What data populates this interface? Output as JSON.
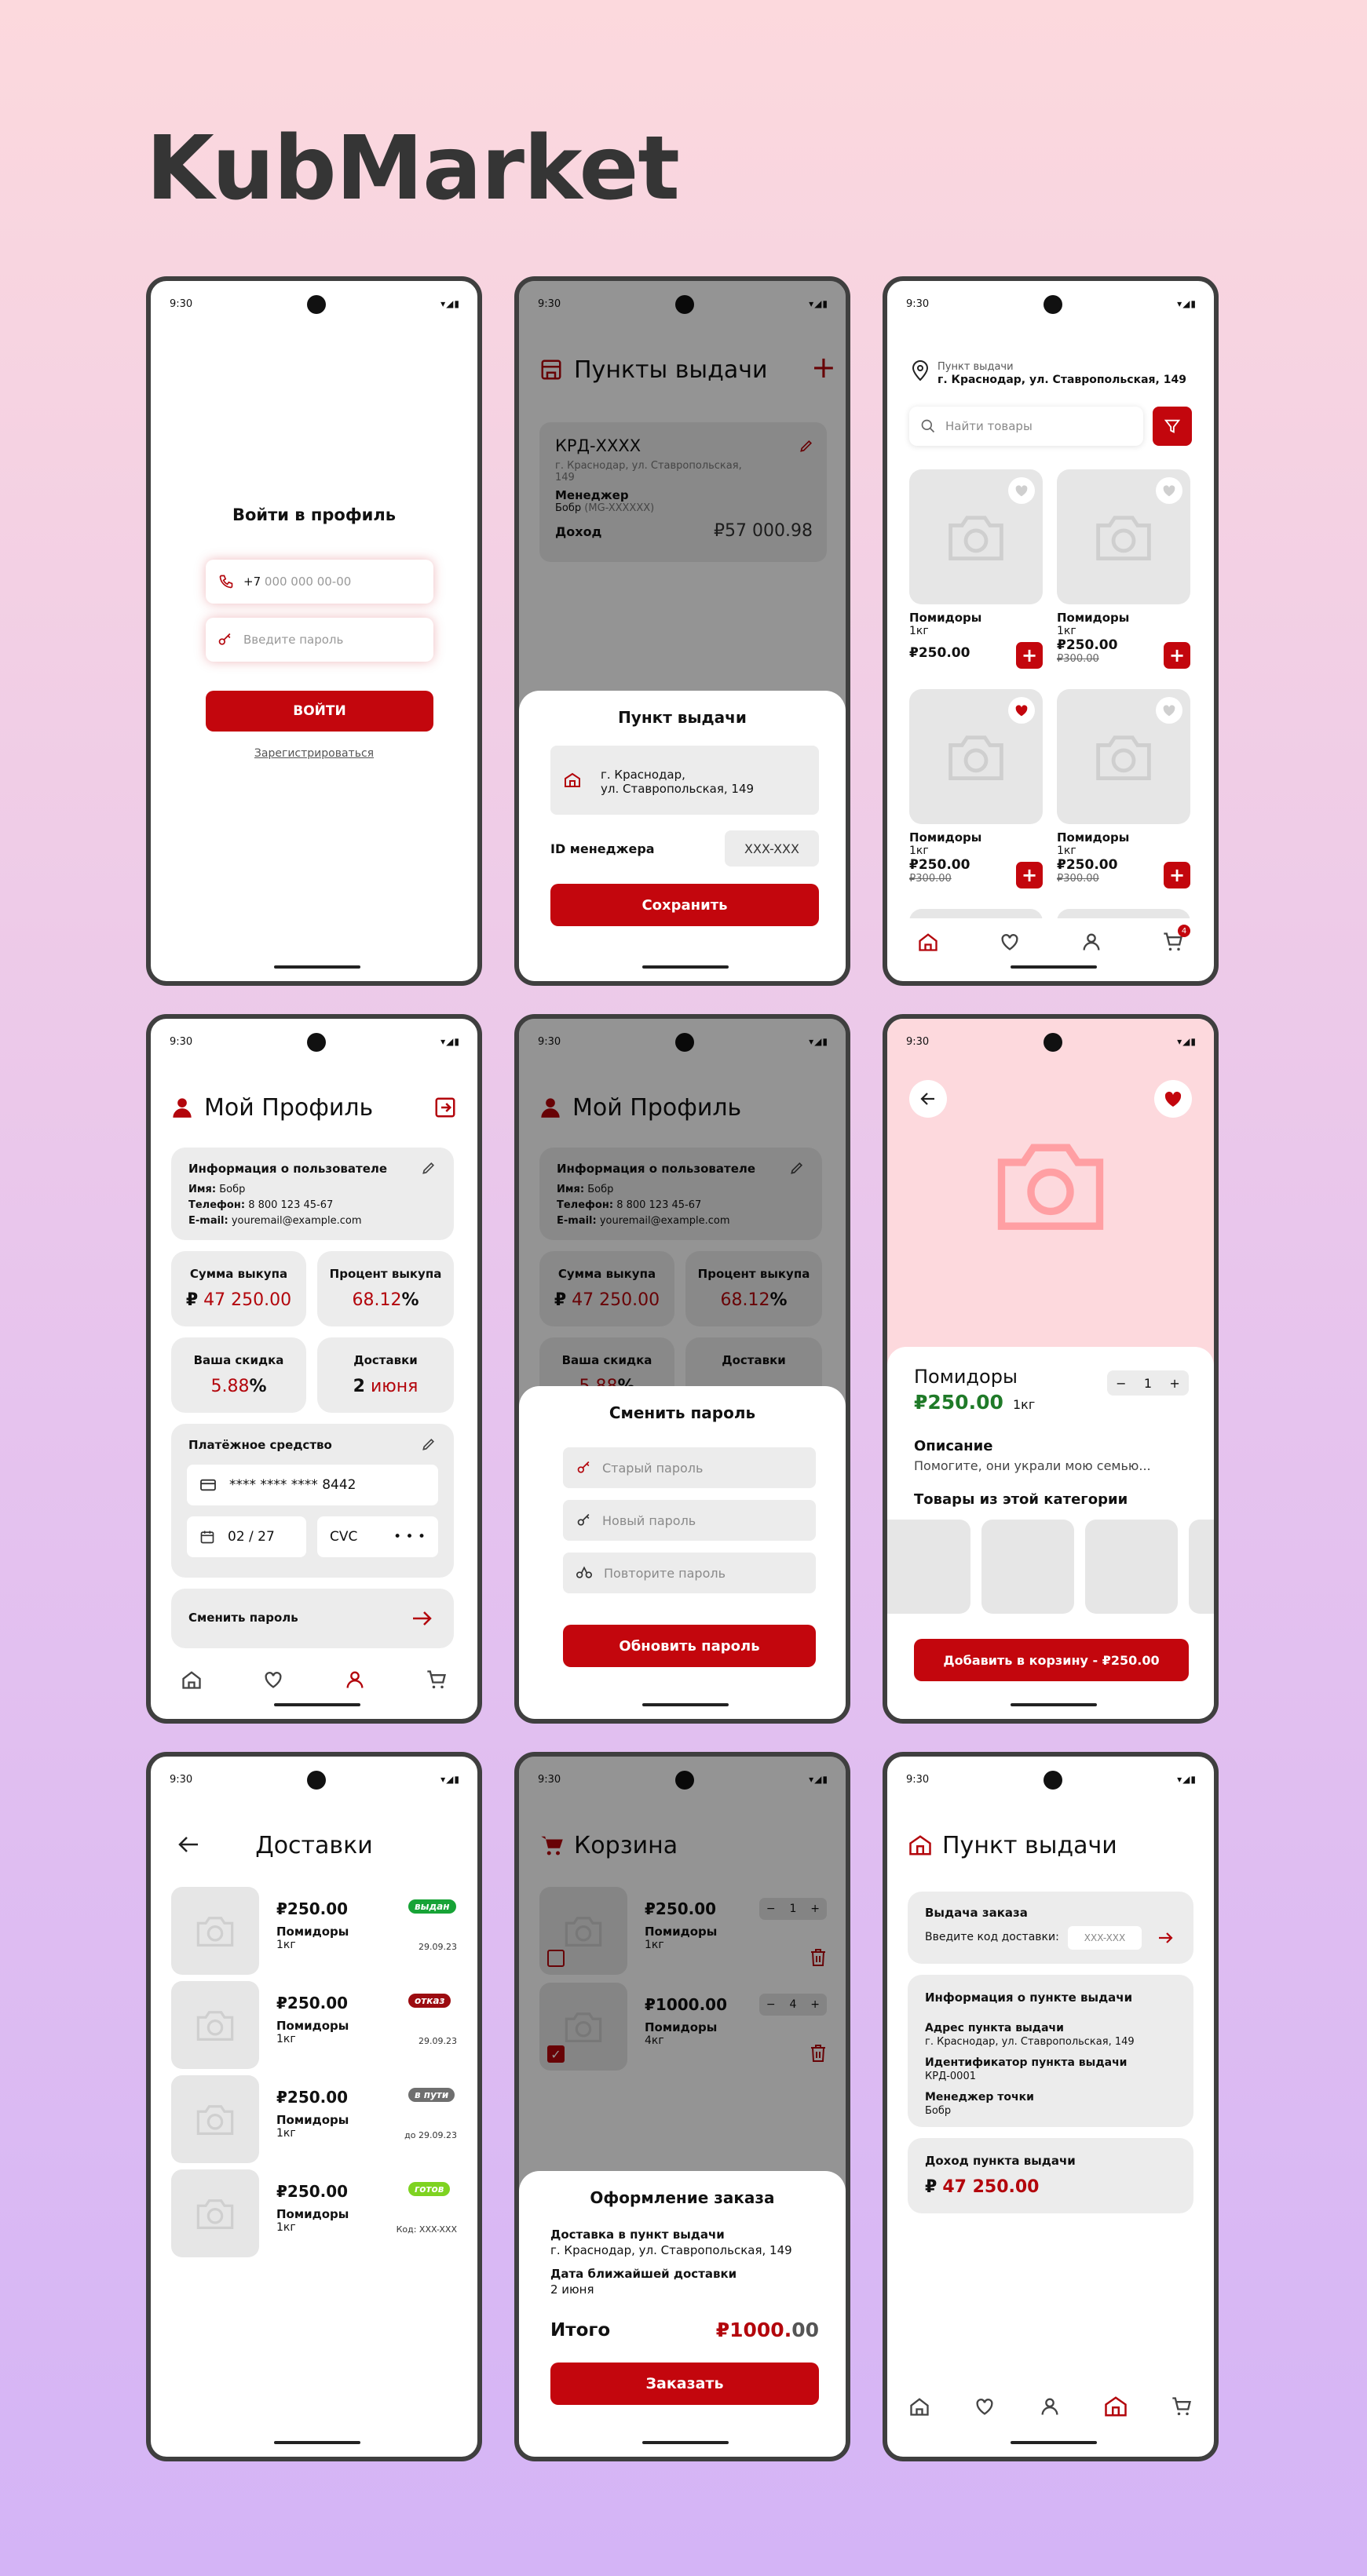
{
  "brand": "KubMarket",
  "status": {
    "time": "9:30",
    "icons": "▾◢▮"
  },
  "login": {
    "title": "Войти в профиль",
    "phone_prefix": "+7",
    "phone_placeholder": "000 000 00-00",
    "password_placeholder": "Введите пароль",
    "login_button": "ВОЙТИ",
    "register_link": "Зарегистрироваться"
  },
  "pickups": {
    "title": "Пункты выдачи",
    "card": {
      "code": "КРД-XXXX",
      "address": "г. Краснодар, ул. Ставропольская, 149",
      "manager_label": "Менеджер",
      "manager_name": "Бобр",
      "manager_id": "(MG-XXXXXX)",
      "income_label": "Доход",
      "income_value": "₽57 000.98"
    },
    "sheet": {
      "title": "Пункт выдачи",
      "address_line1": "г. Краснодар,",
      "address_line2": "ул. Ставропольская, 149",
      "manager_id_label": "ID менеджера",
      "manager_id_value": "XXX-XXX",
      "save_button": "Сохранить"
    }
  },
  "catalog": {
    "location_label": "Пункт выдачи",
    "location_address": "г. Краснодар, ул. Ставропольская, 149",
    "search_placeholder": "Найти товары",
    "cart_count": "4",
    "products": [
      {
        "name": "Помидоры",
        "weight": "1кг",
        "price": "₽250.00",
        "old_price": "",
        "favorite": false
      },
      {
        "name": "Помидоры",
        "weight": "1кг",
        "price": "₽250.00",
        "old_price": "₽300.00",
        "favorite": false
      },
      {
        "name": "Помидоры",
        "weight": "1кг",
        "price": "₽250.00",
        "old_price": "₽300.00",
        "favorite": true
      },
      {
        "name": "Помидоры",
        "weight": "1кг",
        "price": "₽250.00",
        "old_price": "₽300.00",
        "favorite": false
      }
    ]
  },
  "profile": {
    "title": "Мой Профиль",
    "info_title": "Информация о пользователе",
    "name_label": "Имя:",
    "name_value": "Бобр",
    "phone_label": "Телефон:",
    "phone_value": "8 800 123 45-67",
    "email_label": "E-mail:",
    "email_value": "youremail@example.com",
    "stats": {
      "buyout_sum_label": "Сумма выкупа",
      "buyout_sum_prefix": "₽",
      "buyout_sum_value": "47 250.00",
      "buyout_percent_label": "Процент выкупа",
      "buyout_percent_value": "68.12",
      "percent_sign": "%",
      "discount_label": "Ваша скидка",
      "discount_value": "5.88",
      "deliveries_label": "Доставки",
      "deliveries_day": "2",
      "deliveries_month": "июня"
    },
    "payment_title": "Платёжное средство",
    "card_masked": "**** **** ****",
    "card_last": "8442",
    "card_expiry": "02 / 27",
    "cvc_label": "CVC",
    "cvc_dots": "• • •",
    "change_password": "Сменить пароль"
  },
  "change_password": {
    "title": "Сменить пароль",
    "old_placeholder": "Старый пароль",
    "new_placeholder": "Новый пароль",
    "repeat_placeholder": "Повторите пароль",
    "submit_button": "Обновить пароль"
  },
  "product": {
    "name": "Помидоры",
    "price": "₽250.00",
    "weight": "1кг",
    "quantity": "1",
    "description_title": "Описание",
    "description_text": "Помогите, они украли мою семью...",
    "category_title": "Товары из этой категории",
    "add_button": "Добавить в корзину - ₽250.00"
  },
  "deliveries": {
    "title": "Доставки",
    "items": [
      {
        "price": "₽250.00",
        "name": "Помидоры",
        "weight": "1кг",
        "status": "выдан",
        "status_color": "#17a336",
        "meta": "29.09.23"
      },
      {
        "price": "₽250.00",
        "name": "Помидоры",
        "weight": "1кг",
        "status": "отказ",
        "status_color": "#9c0b10",
        "meta": "29.09.23"
      },
      {
        "price": "₽250.00",
        "name": "Помидоры",
        "weight": "1кг",
        "status": "в пути",
        "status_color": "#6f6f6f",
        "meta": "до 29.09.23"
      },
      {
        "price": "₽250.00",
        "name": "Помидоры",
        "weight": "1кг",
        "status": "готов",
        "status_color": "#7ed321",
        "meta": "Код: XXX-XXX"
      }
    ]
  },
  "cart": {
    "title": "Корзина",
    "items": [
      {
        "price": "₽250.00",
        "name": "Помидоры",
        "weight": "1кг",
        "quantity": "1",
        "checked": false
      },
      {
        "price": "₽1000.00",
        "name": "Помидоры",
        "weight": "4кг",
        "quantity": "4",
        "checked": true
      }
    ],
    "order": {
      "title": "Оформление заказа",
      "delivery_label": "Доставка в пункт выдачи",
      "delivery_address": "г. Краснодар, ул. Ставропольская, 149",
      "date_label": "Дата ближайшей доставки",
      "date_value": "2 июня",
      "total_label": "Итого",
      "total_main": "₽1000.",
      "total_cents": "00",
      "order_button": "Заказать"
    }
  },
  "pickup_point": {
    "title": "Пункт выдачи",
    "issue_title": "Выдача заказа",
    "code_label": "Введите код доставки:",
    "code_placeholder": "XXX-XXX",
    "info_title": "Информация о пункте выдачи",
    "address_label": "Адрес пункта выдачи",
    "address_value": "г. Краснодар, ул. Ставропольская, 149",
    "id_label": "Идентификатор пункта выдачи",
    "id_value": "КРД-0001",
    "manager_label": "Менеджер точки",
    "manager_value": "Бобр",
    "income_title": "Доход пункта выдачи",
    "income_prefix": "₽",
    "income_value": "47 250.00"
  },
  "colors": {
    "accent": "#c3060d",
    "dark_red": "#9c0b10",
    "green": "#1f7a28"
  }
}
